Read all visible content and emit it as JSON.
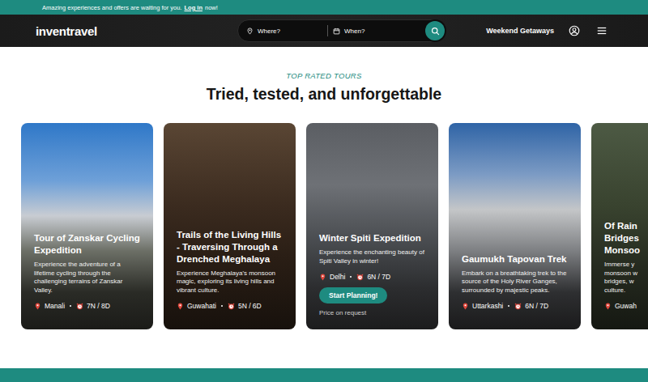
{
  "banner": {
    "text": "Amazing experiences and offers are waiting for you.",
    "link": "Log in",
    "suffix": "now!"
  },
  "header": {
    "logo": "inventravel",
    "search": {
      "where": "Where?",
      "when": "When?"
    },
    "nav": "Weekend Getaways"
  },
  "section": {
    "eyebrow": "TOP RATED TOURS",
    "title": "Tried, tested, and unforgettable"
  },
  "tours": [
    {
      "kind": "card",
      "expanded": false,
      "title": "Tour of Zanskar Cycling Expedition",
      "description": "Experience the adventure of a lifetime cycling through the challenging terrains of Zanskar Valley.",
      "location": "Manali",
      "duration": "7N / 8D"
    },
    {
      "kind": "card",
      "expanded": false,
      "title": "Trails of the Living Hills - Traversing Through a Drenched Meghalaya",
      "description": "Experience Meghalaya's monsoon magic, exploring its living hills and vibrant culture.",
      "location": "Guwahati",
      "duration": "5N / 6D"
    },
    {
      "kind": "card",
      "expanded": true,
      "title": "Winter Spiti Expedition",
      "description": "Experience the enchanting beauty of Spiti Valley in winter!",
      "location": "Delhi",
      "duration": "6N / 7D",
      "button": "Start Planning!",
      "price": "Price on request"
    },
    {
      "kind": "card",
      "expanded": false,
      "title": "Gaumukh Tapovan Trek",
      "description": "Embark on a breathtaking trek to the source of the Holy River Ganges, surrounded by majestic peaks.",
      "location": "Uttarkashi",
      "duration": "6N / 7D"
    },
    {
      "kind": "peek",
      "expanded": false,
      "title": "Of Rain Bridges Monsoo",
      "description": "Immerse y monsoon w bridges, w culture.",
      "location": "Guwah"
    }
  ]
}
